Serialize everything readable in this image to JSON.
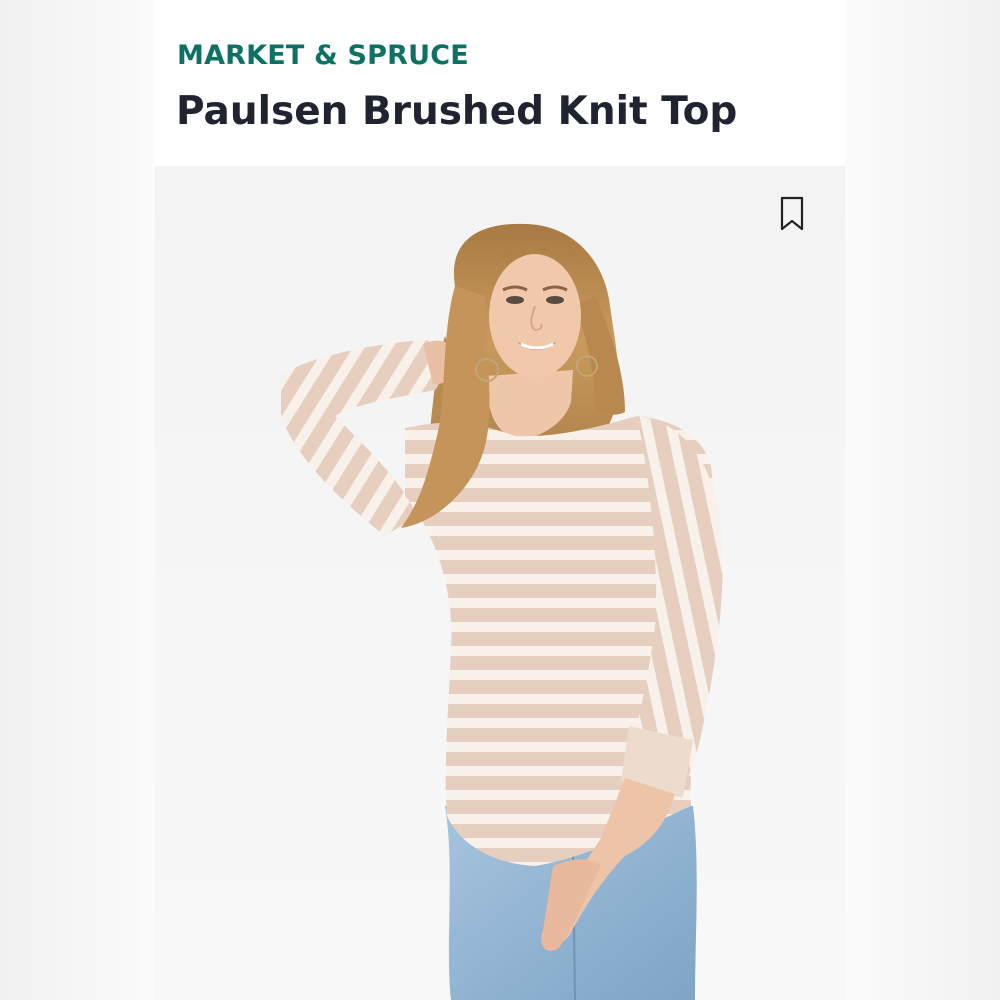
{
  "product": {
    "brand": "MARKET & SPRUCE",
    "title": "Paulsen Brushed Knit Top"
  },
  "colors": {
    "brand": "#0f7163",
    "title": "#1f2430",
    "photo_background": "#f2f2f2",
    "top_stripe_base": "#e7d0c0",
    "top_stripe_light": "#f8f1ea",
    "jeans": "#8fb2cf"
  },
  "icons": {
    "bookmark": "bookmark-icon"
  }
}
